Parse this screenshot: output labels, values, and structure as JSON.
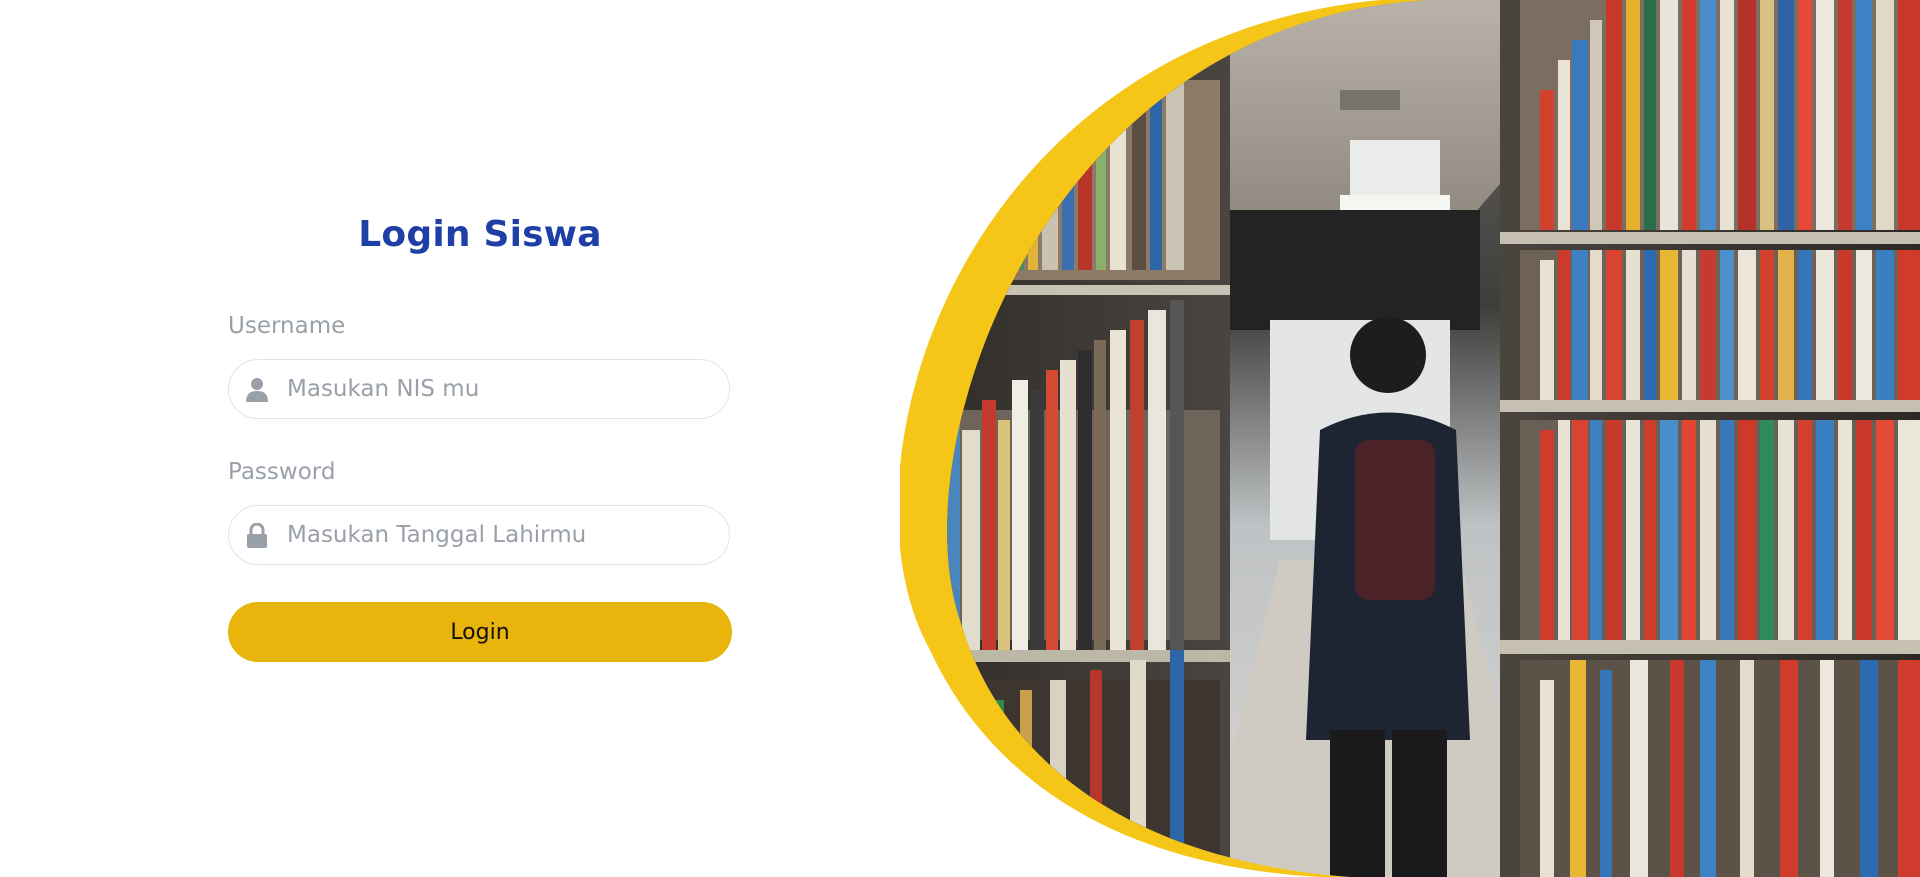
{
  "login": {
    "title": "Login Siswa",
    "username_label": "Username",
    "username_placeholder": "Masukan NIS mu",
    "username_value": "",
    "username_icon": "user-icon",
    "password_label": "Password",
    "password_placeholder": "Masukan Tanggal Lahirmu",
    "password_value": "",
    "password_icon": "lock-icon",
    "button_label": "Login"
  },
  "theme": {
    "title_color": "#1f3fa6",
    "button_color": "#e9b40c",
    "accent_arc_color": "#f5c518",
    "muted_text_color": "#9aa0a8"
  },
  "hero": {
    "subject": "library-aisle-photo"
  }
}
